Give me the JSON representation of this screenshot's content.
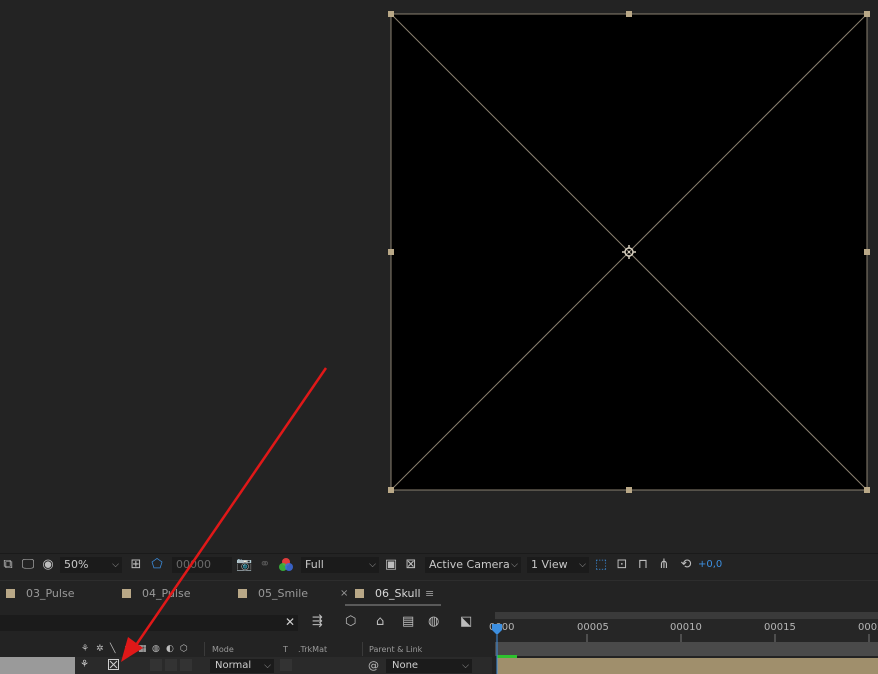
{
  "viewer": {
    "zoom": "50%",
    "timecode": "00000",
    "resolution": "Full",
    "camera": "Active Camera",
    "view_layout": "1 View",
    "exposure": "+0,0"
  },
  "tabs": [
    {
      "label": "03_Pulse",
      "active": false
    },
    {
      "label": "04_Pulse",
      "active": false
    },
    {
      "label": "05_Smile",
      "active": false
    },
    {
      "label": "06_Skull",
      "active": true
    }
  ],
  "timeline": {
    "columns": {
      "mode": "Mode",
      "t": "T",
      "trkmat": ".TrkMat",
      "parent": "Parent & Link"
    },
    "ruler_labels": [
      "0000",
      "00005",
      "00010",
      "00015",
      "0002"
    ],
    "layer": {
      "mode": "Normal",
      "parent": "None"
    }
  },
  "colors": {
    "label_color": "#b9a887",
    "accent_blue": "#3d8fe0",
    "arrow_red": "#e01818"
  }
}
